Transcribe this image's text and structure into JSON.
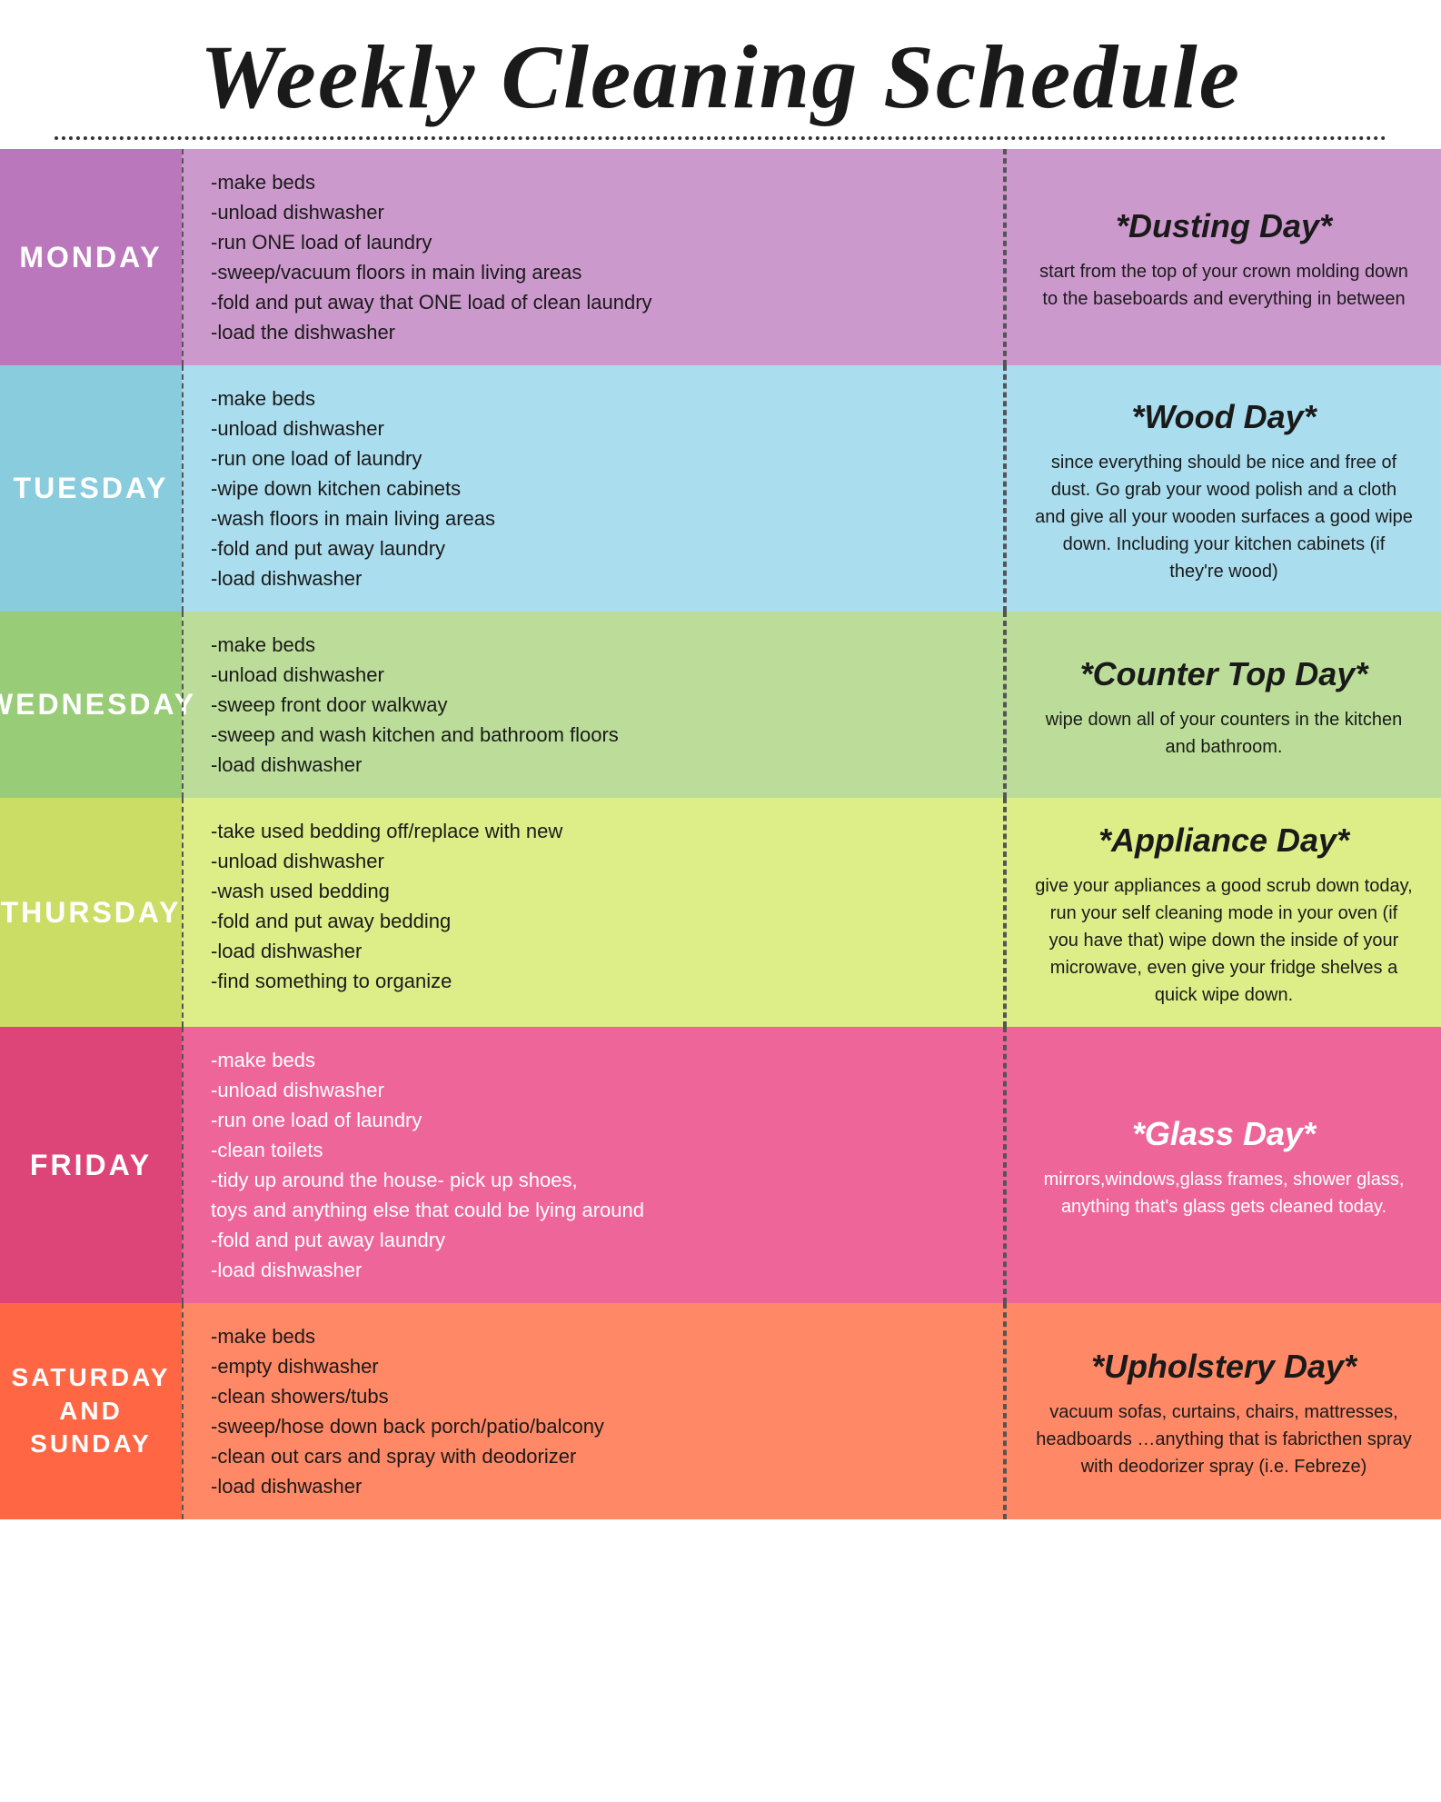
{
  "header": {
    "title": "Weekly Cleaning Schedule"
  },
  "days": [
    {
      "label": "MONDAY",
      "tasks": [
        "-make beds",
        "-unload dishwasher",
        "-run ONE load of laundry",
        "-sweep/vacuum floors in main living areas",
        "-fold and put away that ONE load of clean laundry",
        "-load the dishwasher"
      ],
      "special": {
        "title": "*Dusting Day*",
        "desc": "start from the top of your crown molding down to the baseboards and everything in between"
      }
    },
    {
      "label": "TUESDAY",
      "tasks": [
        "-make beds",
        "-unload dishwasher",
        "-run one load of laundry",
        "-wipe down kitchen cabinets",
        "-wash floors in main living areas",
        "-fold and put away laundry",
        "-load dishwasher"
      ],
      "special": {
        "title": "*Wood Day*",
        "desc": "since everything should be nice and free of dust. Go grab your wood polish and a cloth and give all your wooden surfaces a good wipe down. Including your kitchen cabinets (if they're wood)"
      }
    },
    {
      "label": "WEDNESDAY",
      "tasks": [
        "-make beds",
        "-unload dishwasher",
        "-sweep front door walkway",
        "-sweep and wash kitchen and\n  bathroom floors",
        "-load dishwasher",
        ""
      ],
      "special": {
        "title": "*Counter Top Day*",
        "desc": "wipe down all of your counters in the kitchen and bathroom."
      }
    },
    {
      "label": "THURSDAY",
      "tasks": [
        "-take used bedding off/replace with new",
        "-unload dishwasher",
        "-wash used bedding",
        "-fold and put away bedding",
        "-load dishwasher",
        "-find something to organize"
      ],
      "special": {
        "title": "*Appliance Day*",
        "desc": "give your appliances a good scrub down today, run your self cleaning mode in your oven (if you have that) wipe down the inside of your microwave, even give your fridge shelves a quick wipe down."
      }
    },
    {
      "label": "FRIDAY",
      "tasks": [
        "-make beds",
        "-unload dishwasher",
        "-run one load of laundry",
        "-clean toilets",
        "-tidy up around the house- pick up shoes,",
        " toys and anything else that could be lying around",
        "-fold and put away laundry",
        "-load dishwasher"
      ],
      "special": {
        "title": "*Glass Day*",
        "desc": "mirrors,windows,glass frames, shower glass, anything that's glass gets cleaned today."
      }
    },
    {
      "label": "SATURDAY\nAND\nSUNDAY",
      "tasks": [
        "-make beds",
        "-empty dishwasher",
        "-clean showers/tubs",
        "-sweep/hose down back porch/patio/balcony",
        "-clean out cars and spray with deodorizer",
        "-load dishwasher"
      ],
      "special": {
        "title": "*Upholstery Day*",
        "desc": "vacuum sofas, curtains, chairs, mattresses, headboards …anything that is fabricthen spray with deodorizer spray (i.e. Febreze)"
      }
    }
  ]
}
